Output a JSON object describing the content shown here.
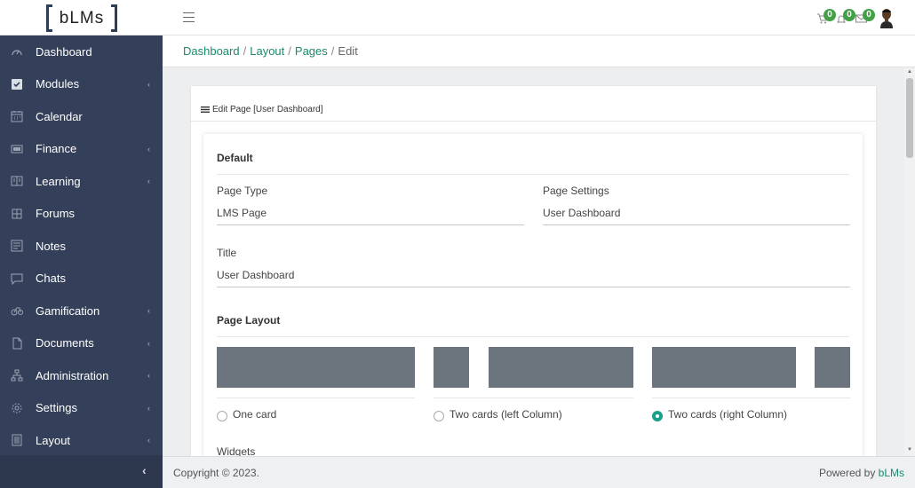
{
  "app": {
    "logo": "bLMs"
  },
  "topbar": {
    "cart_badge": "0",
    "notif_badge": "0",
    "mail_badge": "0"
  },
  "sidebar": {
    "items": [
      {
        "label": "Dashboard",
        "icon": "dashboard-icon",
        "chevron": ""
      },
      {
        "label": "Modules",
        "icon": "checkbox-icon",
        "chevron": "‹"
      },
      {
        "label": "Calendar",
        "icon": "calendar-icon",
        "chevron": ""
      },
      {
        "label": "Finance",
        "icon": "finance-icon",
        "chevron": "‹"
      },
      {
        "label": "Learning",
        "icon": "learning-icon",
        "chevron": "‹"
      },
      {
        "label": "Forums",
        "icon": "forums-icon",
        "chevron": ""
      },
      {
        "label": "Notes",
        "icon": "notes-icon",
        "chevron": ""
      },
      {
        "label": "Chats",
        "icon": "chats-icon",
        "chevron": ""
      },
      {
        "label": "Gamification",
        "icon": "gamification-icon",
        "chevron": "‹"
      },
      {
        "label": "Documents",
        "icon": "documents-icon",
        "chevron": "‹"
      },
      {
        "label": "Administration",
        "icon": "administration-icon",
        "chevron": "‹"
      },
      {
        "label": "Settings",
        "icon": "settings-icon",
        "chevron": "‹"
      },
      {
        "label": "Layout",
        "icon": "layout-icon",
        "chevron": "‹"
      }
    ],
    "collapse": "‹"
  },
  "breadcrumb": {
    "items": [
      "Dashboard",
      "Layout",
      "Pages"
    ],
    "current": "Edit",
    "sep": "/"
  },
  "card": {
    "title": "Edit Page [User Dashboard]"
  },
  "form": {
    "default_title": "Default",
    "page_type_label": "Page Type",
    "page_type_value": "LMS Page",
    "page_settings_label": "Page Settings",
    "page_settings_value": "User Dashboard",
    "title_label": "Title",
    "title_value": "User Dashboard",
    "layout_title": "Page Layout",
    "options": [
      {
        "label": "One card",
        "selected": false
      },
      {
        "label": "Two cards (left Column)",
        "selected": false
      },
      {
        "label": "Two cards (right Column)",
        "selected": true
      }
    ],
    "widgets_label": "Widgets"
  },
  "footer": {
    "copyright": "Copyright © 2023.",
    "powered_prefix": "Powered by ",
    "powered_link": "bLMs"
  },
  "colors": {
    "sidebar_bg": "#34405a",
    "accent": "#1a8a6e",
    "badge": "#43a047",
    "layout_block": "#6c757d"
  }
}
